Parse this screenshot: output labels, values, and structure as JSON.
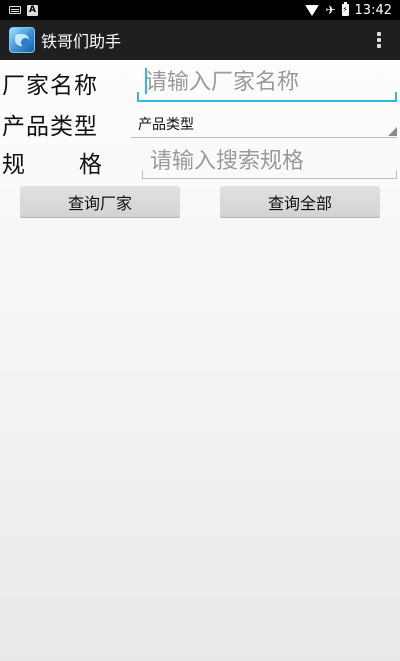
{
  "status_bar": {
    "time": "13:42",
    "left_icons": [
      "keyboard-icon",
      "a-icon"
    ],
    "right_icons": [
      "wifi-icon",
      "airplane-icon",
      "battery-charging-icon"
    ],
    "a_letter": "A",
    "airplane_glyph": "✈"
  },
  "action_bar": {
    "title": "铁哥们助手",
    "app_icon": "app-logo-icon",
    "menu_icon": "overflow-menu-icon"
  },
  "form": {
    "manufacturer_label": "厂家名称",
    "manufacturer_placeholder": "请输入厂家名称",
    "product_type_label": "产品类型",
    "product_type_selected": "产品类型",
    "spec_label_chars": [
      "规",
      "格"
    ],
    "spec_placeholder": "请输入搜索规格"
  },
  "buttons": {
    "query_manufacturer": "查询厂家",
    "query_all": "查询全部"
  },
  "colors": {
    "accent": "#33b5e5",
    "status_bar": "#000000",
    "action_bar": "#1f1f1f",
    "button": "#d9d9d9"
  }
}
